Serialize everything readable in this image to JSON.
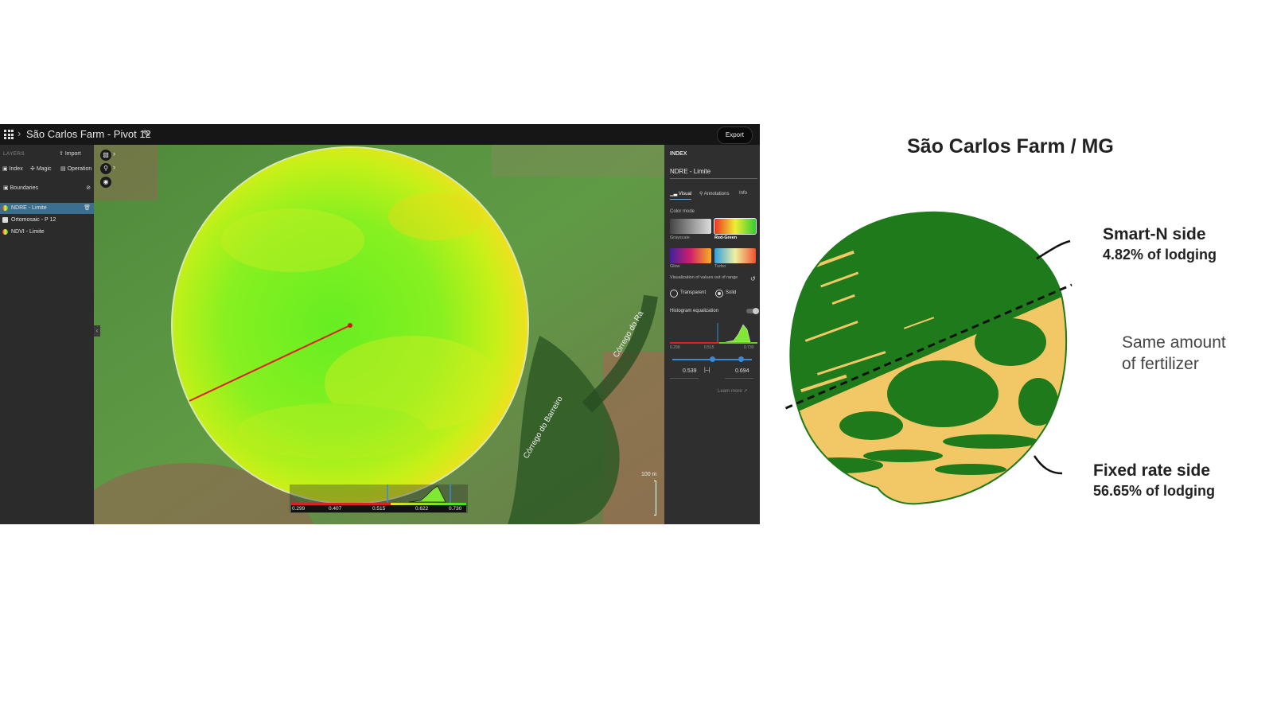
{
  "app": {
    "breadcrumb_title": "São Carlos Farm - Pivot 12",
    "export_label": "Export",
    "icons": {
      "apps": "apps-grid-icon",
      "edit": "pencil-icon"
    }
  },
  "left_panel": {
    "layers_heading": "LAYERS",
    "import_label": "Import",
    "tools": [
      "Index",
      "Magic",
      "Operation"
    ],
    "boundaries_label": "Boundaries",
    "layers": [
      {
        "name": "NDRE - Limite",
        "selected": true
      },
      {
        "name": "Ortomosaic - P 12",
        "selected": false
      },
      {
        "name": "NDVI - Limite",
        "selected": false
      }
    ]
  },
  "map": {
    "labels": [
      "Córrego do Barreiro",
      "Córrego do Ra"
    ],
    "legend_ticks": [
      "0.299",
      "0.407",
      "0.515",
      "0.622",
      "0.730"
    ],
    "scale_label": "100 m"
  },
  "right_panel": {
    "heading": "INDEX",
    "index_value": "NDRE - Limite",
    "tabs": [
      "Visual",
      "Annotations",
      "Info"
    ],
    "color_mode_label": "Color mode",
    "color_modes": [
      "Grayscale",
      "Red-Green",
      "Glow",
      "Turbo"
    ],
    "selected_color_mode": "Red-Green",
    "out_of_range_label": "Visualization of values out of range",
    "out_of_range_options": [
      "Transparent",
      "Solid"
    ],
    "out_of_range_selected": "Solid",
    "histogram_label": "Histogram equalization",
    "hist_ticks": [
      "0.299",
      "0.515",
      "0.730"
    ],
    "range_min": "0.539",
    "range_max": "0.694",
    "learn_more": "Learn more"
  },
  "infographic": {
    "title": "São Carlos Farm / MG",
    "smart_side": "Smart-N side",
    "smart_lodging": "4.82% of lodging",
    "same_line1": "Same amount",
    "same_line2": "of fertilizer",
    "fixed_side": "Fixed rate side",
    "fixed_lodging": "56.65% of lodging",
    "colors": {
      "healthy": "#1e7a1a",
      "lodging": "#f2c867"
    }
  }
}
